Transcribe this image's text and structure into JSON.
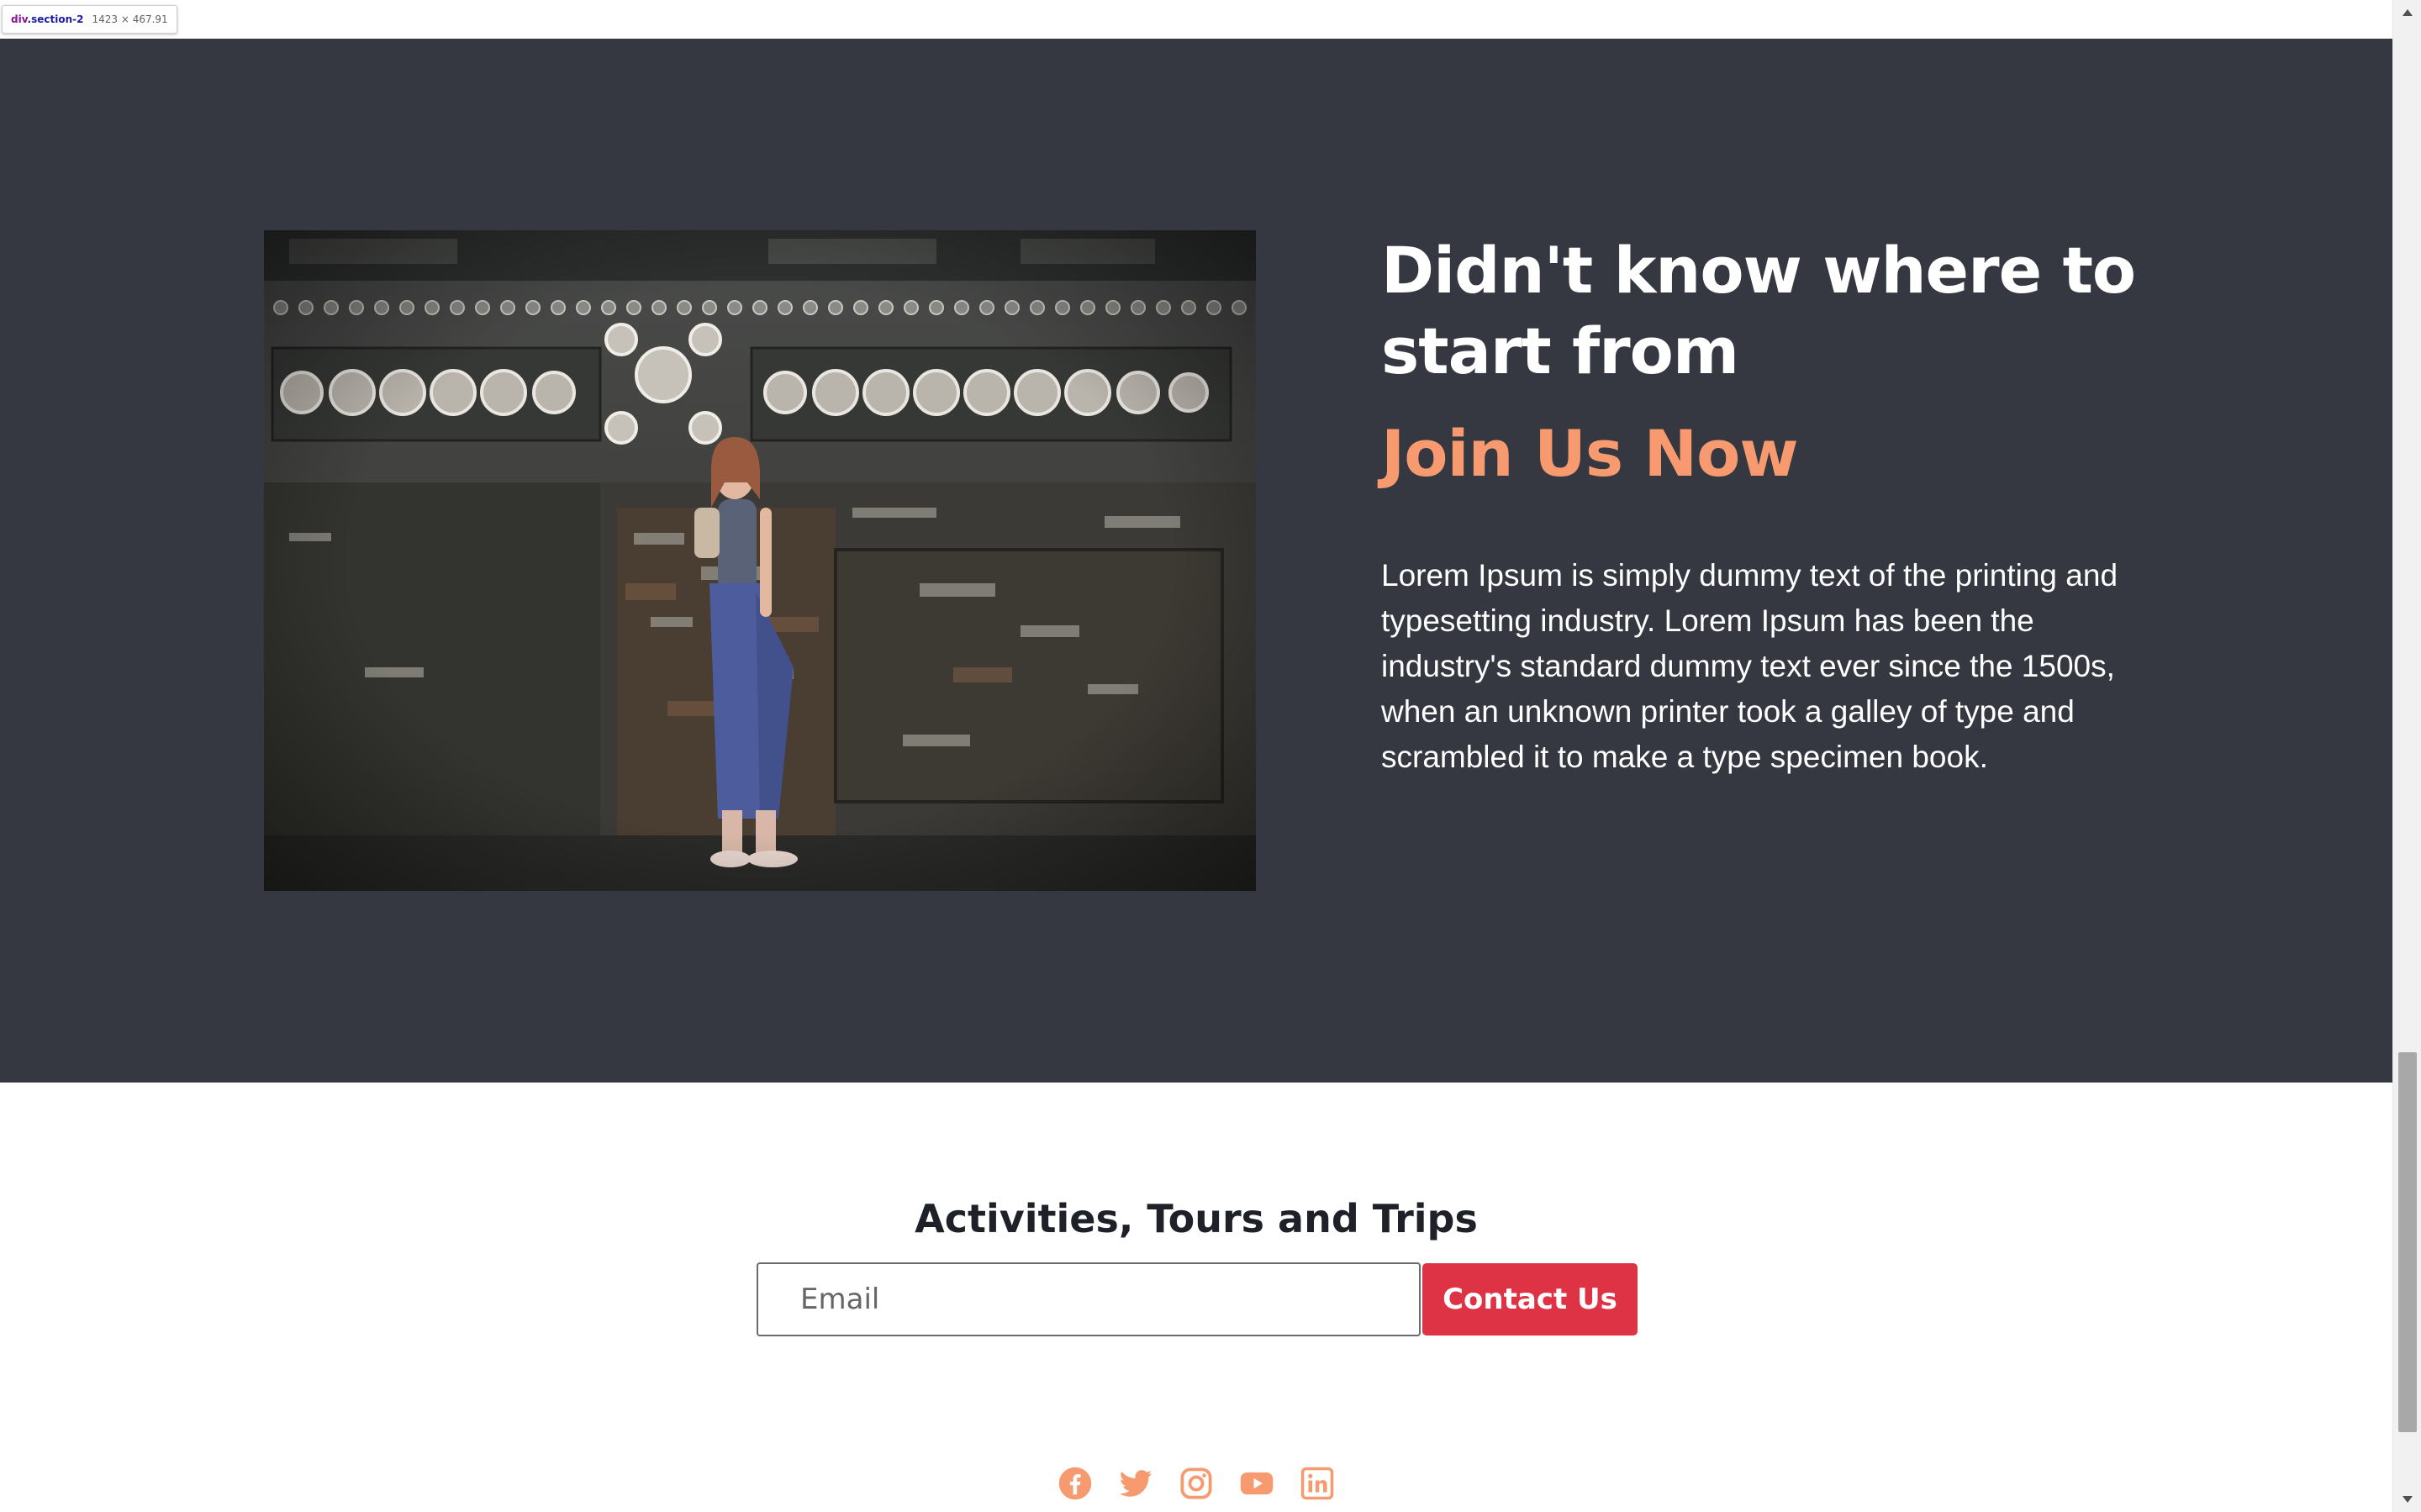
{
  "devtools_tooltip": {
    "tag": "div",
    "class_name": ".section-2",
    "dimensions": "1423 × 467.91"
  },
  "hero": {
    "image_alt": "woman standing in front of an ornate weathered temple wall",
    "heading": "Didn't know where to start from",
    "cta": "Join Us Now",
    "body": "Lorem Ipsum is simply dummy text of the printing and typesetting industry. Lorem Ipsum has been the industry's standard dummy text ever since the 1500s, when an unknown printer took a galley of type and scrambled it to make a type specimen book."
  },
  "subscribe": {
    "title": "Activities, Tours and Trips",
    "email_placeholder": "Email",
    "email_value": "",
    "button_label": "Contact Us"
  },
  "social": {
    "icons": [
      "facebook-icon",
      "twitter-icon",
      "instagram-icon",
      "youtube-icon",
      "linkedin-icon"
    ]
  },
  "colors": {
    "section_bg": "#353840",
    "accent": "#f79a6f",
    "button": "#de3245",
    "social": "#f79a6f"
  },
  "scroll": {
    "position": 0.75
  }
}
